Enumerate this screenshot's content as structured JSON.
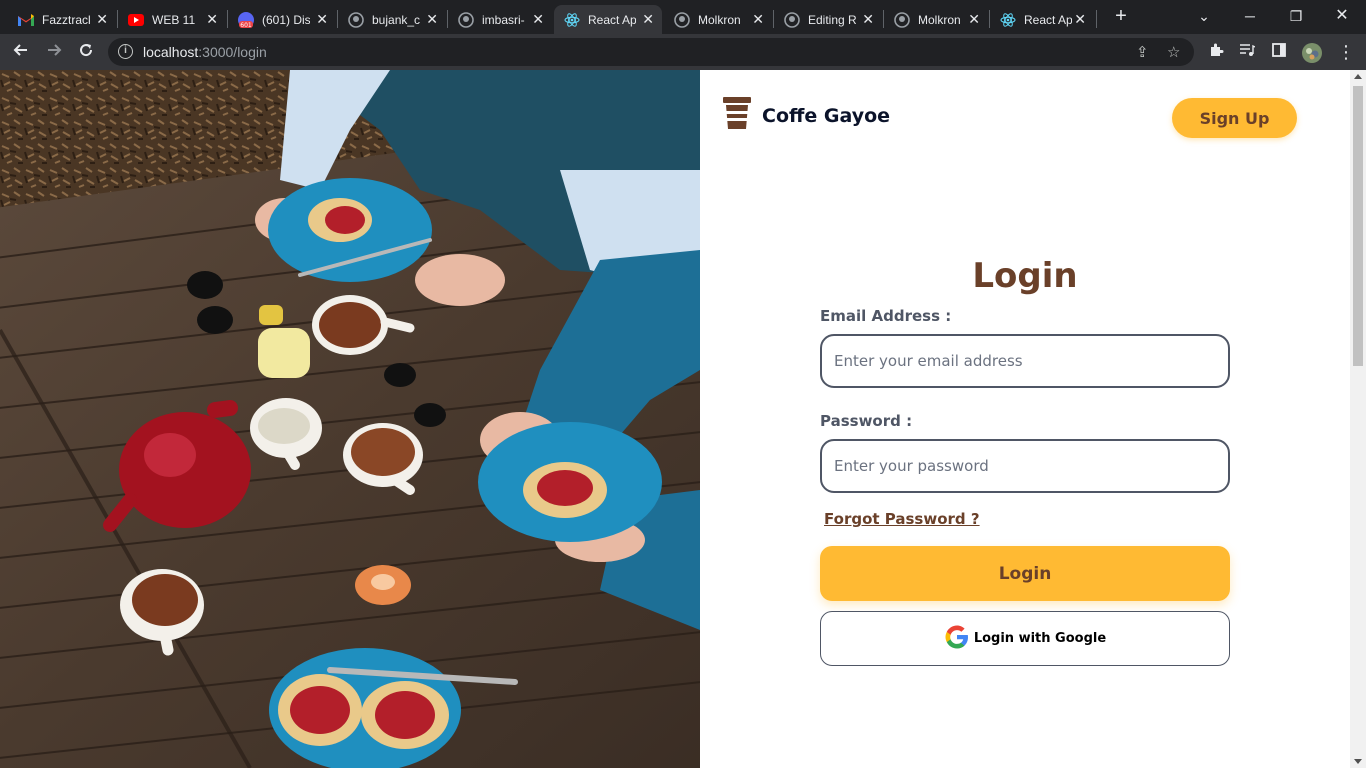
{
  "browser": {
    "tabs": [
      {
        "title": "Fazztrack",
        "icon": "gmail-icon"
      },
      {
        "title": "WEB 11",
        "icon": "youtube-icon"
      },
      {
        "title": "(601) Dis",
        "icon": "discord-icon",
        "badge": "601"
      },
      {
        "title": "bujank_c",
        "icon": "github-icon"
      },
      {
        "title": "imbasri-",
        "icon": "github-icon"
      },
      {
        "title": "React Ap",
        "icon": "react-icon",
        "active": true
      },
      {
        "title": "Molkron",
        "icon": "github-icon"
      },
      {
        "title": "Editing R",
        "icon": "github-icon"
      },
      {
        "title": "Molkron",
        "icon": "github-icon"
      },
      {
        "title": "React Ap",
        "icon": "react-icon"
      }
    ],
    "url_host": "localhost",
    "url_path": ":3000/login"
  },
  "header": {
    "brand_name": "Coffe Gayoe",
    "signup_label": "Sign Up"
  },
  "login": {
    "title": "Login",
    "email_label": "Email Address :",
    "email_placeholder": "Enter your email address",
    "password_label": "Password :",
    "password_placeholder": "Enter your password",
    "forgot_label": "Forgot Password ?",
    "submit_label": "Login",
    "google_label": "Login with Google"
  },
  "colors": {
    "brown": "#6a4029",
    "yellow": "#ffba33",
    "gray_text": "#4f5665",
    "dark": "#0b132a"
  }
}
